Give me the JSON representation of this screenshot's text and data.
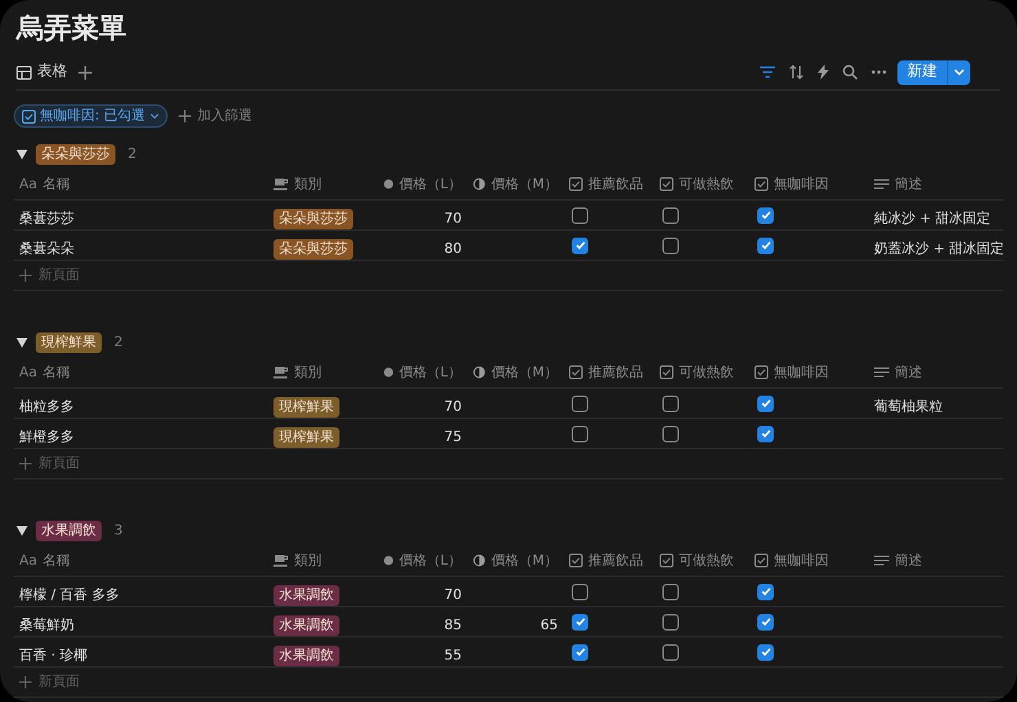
{
  "title": "烏弄菜單",
  "view_tab": {
    "label": "表格",
    "selected": true
  },
  "new_button": {
    "label": "新建"
  },
  "filter_chip": {
    "label": "無咖啡因: 已勾選"
  },
  "add_filter": {
    "label": "加入篩選"
  },
  "groups": [
    {
      "label": "朵朵與莎莎",
      "color": "#8a5524",
      "count": "2",
      "expanded": true,
      "columns": [
        {
          "kind": "title",
          "label": "名稱",
          "icon": "Aa"
        },
        {
          "kind": "select",
          "label": "類別"
        },
        {
          "kind": "number",
          "label": "價格（L）"
        },
        {
          "kind": "formula",
          "label": "價格（M）"
        },
        {
          "kind": "checkbox",
          "label": "推薦飲品"
        },
        {
          "kind": "checkbox",
          "label": "可做熱飲"
        },
        {
          "kind": "checkbox",
          "label": "無咖啡因"
        },
        {
          "kind": "text",
          "label": "簡述"
        }
      ],
      "rows": [
        {
          "name": "桑葚莎莎",
          "category": "朵朵與莎莎",
          "price_l": "70",
          "recommended": false,
          "hot": false,
          "decaf": true,
          "note": "純冰沙 + 甜冰固定"
        },
        {
          "name": "桑葚朵朵",
          "category": "朵朵與莎莎",
          "price_l": "80",
          "recommended": true,
          "hot": false,
          "decaf": true,
          "note": "奶蓋冰沙 + 甜冰固定"
        }
      ],
      "new_page": "新頁面"
    },
    {
      "label": "現榨鮮果",
      "color": "#7d5e2a",
      "count": "2",
      "expanded": true,
      "columns": [
        {
          "kind": "title",
          "label": "名稱",
          "icon": "Aa"
        },
        {
          "kind": "select",
          "label": "類別"
        },
        {
          "kind": "number",
          "label": "價格（L）"
        },
        {
          "kind": "formula",
          "label": "價格（M）"
        },
        {
          "kind": "checkbox",
          "label": "推薦飲品"
        },
        {
          "kind": "checkbox",
          "label": "可做熱飲"
        },
        {
          "kind": "checkbox",
          "label": "無咖啡因"
        },
        {
          "kind": "text",
          "label": "簡述"
        }
      ],
      "rows": [
        {
          "name": "柚粒多多",
          "category": "現榨鮮果",
          "price_l": "70",
          "recommended": false,
          "hot": false,
          "decaf": true,
          "note": "葡萄柚果粒"
        },
        {
          "name": "鮮橙多多",
          "category": "現榨鮮果",
          "price_l": "75",
          "recommended": false,
          "hot": false,
          "decaf": true
        }
      ],
      "new_page": "新頁面"
    },
    {
      "label": "水果調飲",
      "color": "#6b2c45",
      "count": "3",
      "expanded": true,
      "columns": [
        {
          "kind": "title",
          "label": "名稱",
          "icon": "Aa"
        },
        {
          "kind": "select",
          "label": "類別"
        },
        {
          "kind": "number",
          "label": "價格（L）"
        },
        {
          "kind": "formula",
          "label": "價格（M）"
        },
        {
          "kind": "checkbox",
          "label": "推薦飲品"
        },
        {
          "kind": "checkbox",
          "label": "可做熱飲"
        },
        {
          "kind": "checkbox",
          "label": "無咖啡因"
        },
        {
          "kind": "text",
          "label": "簡述"
        }
      ],
      "rows": [
        {
          "name": "檸檬 / 百香 多多",
          "category": "水果調飲",
          "price_l": "70",
          "recommended": false,
          "hot": false,
          "decaf": true
        },
        {
          "name": "桑莓鮮奶",
          "category": "水果調飲",
          "price_l": "85",
          "price_m": "65",
          "recommended": true,
          "hot": false,
          "decaf": true
        },
        {
          "name": "百香 · 珍椰",
          "category": "水果調飲",
          "price_l": "55",
          "recommended": true,
          "hot": false,
          "decaf": true
        }
      ],
      "new_page": "新頁面"
    }
  ]
}
